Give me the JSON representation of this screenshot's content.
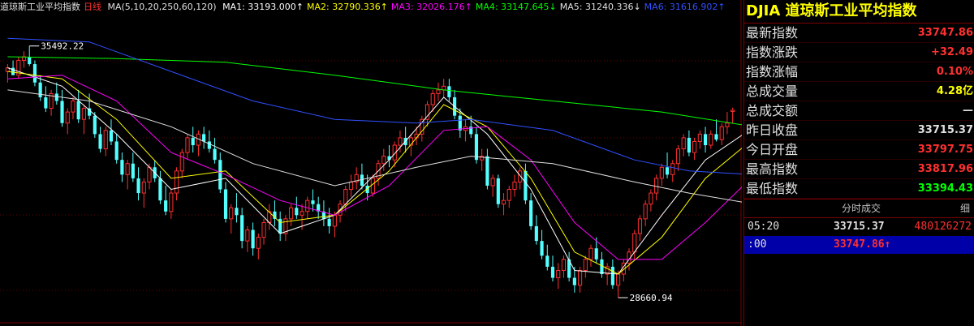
{
  "header": {
    "title": "道琼斯工业平均指数",
    "period": "日线",
    "ma_params": "MA(5,10,20,250,60,120)",
    "mas": [
      {
        "label": "MA1:",
        "value": "33193.000",
        "arrow": "↑",
        "color": "#ffffff"
      },
      {
        "label": "MA2:",
        "value": "32790.336",
        "arrow": "↑",
        "color": "#ffff00"
      },
      {
        "label": "MA3:",
        "value": "32026.176",
        "arrow": "↑",
        "color": "#ff00ff"
      },
      {
        "label": "MA4:",
        "value": "33147.645",
        "arrow": "↓",
        "color": "#00ff00"
      },
      {
        "label": "MA5:",
        "value": "31240.336",
        "arrow": "↓",
        "color": "#e0e0e0"
      },
      {
        "label": "MA6:",
        "value": "31616.902",
        "arrow": "↑",
        "color": "#3050ff"
      }
    ]
  },
  "chart_data": {
    "type": "candlestick",
    "title": "道琼斯工业平均指数",
    "ylim": [
      28200,
      36300
    ],
    "high_label": "35492.22",
    "low_label": "28660.94",
    "up_color": "#ff3030",
    "down_color": "#54ffff",
    "candles": [
      [
        34800,
        35000,
        34500,
        34900
      ],
      [
        34900,
        35100,
        34700,
        34700
      ],
      [
        34700,
        35200,
        34600,
        35100
      ],
      [
        35100,
        35350,
        34900,
        35200
      ],
      [
        35200,
        35492,
        34950,
        35000
      ],
      [
        35000,
        35100,
        34400,
        34500
      ],
      [
        34500,
        34700,
        34000,
        34100
      ],
      [
        34100,
        34400,
        33700,
        33800
      ],
      [
        33800,
        34300,
        33600,
        34200
      ],
      [
        34200,
        34500,
        33900,
        34000
      ],
      [
        34000,
        34300,
        33300,
        33400
      ],
      [
        33400,
        33800,
        33100,
        33700
      ],
      [
        33700,
        34100,
        33500,
        34000
      ],
      [
        34000,
        34300,
        33400,
        33500
      ],
      [
        33500,
        33900,
        33100,
        33800
      ],
      [
        33800,
        34200,
        33500,
        33600
      ],
      [
        33600,
        33700,
        33000,
        33100
      ],
      [
        33100,
        33300,
        32600,
        32700
      ],
      [
        32700,
        33300,
        32500,
        33200
      ],
      [
        33200,
        33500,
        32800,
        32900
      ],
      [
        32900,
        33100,
        32300,
        32400
      ],
      [
        32400,
        32600,
        31800,
        32000
      ],
      [
        32000,
        32400,
        31600,
        32300
      ],
      [
        32300,
        32600,
        31800,
        31900
      ],
      [
        31900,
        32200,
        31300,
        31500
      ],
      [
        31500,
        31900,
        31100,
        31800
      ],
      [
        31800,
        32300,
        31600,
        32200
      ],
      [
        32200,
        32400,
        31800,
        31900
      ],
      [
        31900,
        32100,
        31200,
        31300
      ],
      [
        31300,
        31700,
        30900,
        31000
      ],
      [
        31000,
        31600,
        30800,
        31500
      ],
      [
        31500,
        32200,
        31300,
        32100
      ],
      [
        32100,
        32700,
        31900,
        32600
      ],
      [
        32600,
        33100,
        32400,
        33000
      ],
      [
        33000,
        33300,
        32600,
        32800
      ],
      [
        32800,
        33200,
        32500,
        33100
      ],
      [
        33100,
        33300,
        32700,
        32900
      ],
      [
        32900,
        33200,
        32600,
        32700
      ],
      [
        32700,
        33000,
        32300,
        32400
      ],
      [
        32400,
        32600,
        31500,
        31600
      ],
      [
        31600,
        31800,
        30700,
        30800
      ],
      [
        30800,
        31200,
        30400,
        31100
      ],
      [
        31100,
        31500,
        30700,
        30900
      ],
      [
        30900,
        31100,
        30000,
        30200
      ],
      [
        30200,
        30600,
        29900,
        30500
      ],
      [
        30500,
        30700,
        29800,
        30000
      ],
      [
        30000,
        30400,
        29700,
        30300
      ],
      [
        30300,
        30800,
        30100,
        30700
      ],
      [
        30700,
        31200,
        30500,
        31000
      ],
      [
        31000,
        31300,
        30600,
        30800
      ],
      [
        30800,
        31000,
        30200,
        30400
      ],
      [
        30400,
        30900,
        30200,
        30800
      ],
      [
        30800,
        31200,
        30600,
        31100
      ],
      [
        31100,
        31400,
        30800,
        30900
      ],
      [
        30900,
        31200,
        30500,
        31000
      ],
      [
        31000,
        31400,
        30800,
        31300
      ],
      [
        31300,
        31600,
        31000,
        31200
      ],
      [
        31200,
        31400,
        30800,
        31000
      ],
      [
        31000,
        31300,
        30600,
        30800
      ],
      [
        30800,
        31100,
        30400,
        30600
      ],
      [
        30600,
        31000,
        30300,
        30900
      ],
      [
        30900,
        31300,
        30700,
        31200
      ],
      [
        31200,
        31700,
        31000,
        31600
      ],
      [
        31600,
        32000,
        31400,
        31800
      ],
      [
        31800,
        32200,
        31600,
        32000
      ],
      [
        32000,
        32300,
        31600,
        31700
      ],
      [
        31700,
        32000,
        31300,
        31500
      ],
      [
        31500,
        32000,
        31400,
        31900
      ],
      [
        31900,
        32400,
        31700,
        32300
      ],
      [
        32300,
        32700,
        32100,
        32500
      ],
      [
        32500,
        32800,
        32200,
        32400
      ],
      [
        32400,
        32900,
        32200,
        32800
      ],
      [
        32800,
        33200,
        32600,
        33000
      ],
      [
        33000,
        33300,
        32600,
        32800
      ],
      [
        32800,
        33100,
        32500,
        33000
      ],
      [
        33000,
        33300,
        32800,
        33100
      ],
      [
        33100,
        33600,
        32900,
        33500
      ],
      [
        33500,
        34000,
        33300,
        33900
      ],
      [
        33900,
        34300,
        33700,
        34200
      ],
      [
        34200,
        34500,
        34000,
        34300
      ],
      [
        34300,
        34600,
        34100,
        34400
      ],
      [
        34400,
        34600,
        34000,
        34100
      ],
      [
        34100,
        34300,
        33500,
        33600
      ],
      [
        33600,
        33800,
        33000,
        33200
      ],
      [
        33200,
        33500,
        32900,
        33300
      ],
      [
        33300,
        33600,
        33000,
        33100
      ],
      [
        33100,
        33300,
        32300,
        32400
      ],
      [
        32400,
        32700,
        32100,
        32500
      ],
      [
        32500,
        32700,
        31600,
        31700
      ],
      [
        31700,
        32000,
        31400,
        31900
      ],
      [
        31900,
        32000,
        31100,
        31200
      ],
      [
        31200,
        31500,
        30900,
        31300
      ],
      [
        31300,
        31700,
        31100,
        31600
      ],
      [
        31600,
        32000,
        31400,
        31800
      ],
      [
        31800,
        32200,
        31600,
        32100
      ],
      [
        32100,
        32300,
        31200,
        31300
      ],
      [
        31300,
        31500,
        30500,
        30600
      ],
      [
        30600,
        30900,
        30100,
        30200
      ],
      [
        30200,
        30500,
        29700,
        29800
      ],
      [
        29800,
        30100,
        29400,
        29500
      ],
      [
        29500,
        29800,
        29100,
        29200
      ],
      [
        29200,
        29600,
        28900,
        29400
      ],
      [
        29400,
        29800,
        29200,
        29700
      ],
      [
        29700,
        29900,
        29100,
        29200
      ],
      [
        29200,
        29500,
        28800,
        29000
      ],
      [
        29000,
        29500,
        28800,
        29400
      ],
      [
        29400,
        29800,
        29200,
        29700
      ],
      [
        29700,
        30100,
        29500,
        30000
      ],
      [
        30000,
        30300,
        29600,
        29700
      ],
      [
        29700,
        29900,
        29200,
        29300
      ],
      [
        29300,
        29600,
        29000,
        29500
      ],
      [
        29500,
        29700,
        28900,
        29000
      ],
      [
        29000,
        29400,
        28661,
        29300
      ],
      [
        29300,
        29700,
        29100,
        29600
      ],
      [
        29600,
        30000,
        29400,
        29900
      ],
      [
        29900,
        30500,
        29700,
        30400
      ],
      [
        30400,
        30900,
        30200,
        30800
      ],
      [
        30800,
        31300,
        30600,
        31200
      ],
      [
        31200,
        31600,
        31000,
        31500
      ],
      [
        31500,
        32000,
        31300,
        31900
      ],
      [
        31900,
        32300,
        31700,
        32200
      ],
      [
        32200,
        32600,
        31900,
        32000
      ],
      [
        32000,
        32400,
        31800,
        32300
      ],
      [
        32300,
        32800,
        32100,
        32700
      ],
      [
        32700,
        33100,
        32500,
        33000
      ],
      [
        33000,
        33200,
        32500,
        32600
      ],
      [
        32600,
        33000,
        32400,
        32900
      ],
      [
        32900,
        33200,
        32700,
        33100
      ],
      [
        33100,
        33300,
        32600,
        32800
      ],
      [
        32800,
        33200,
        32700,
        33100
      ],
      [
        33100,
        33500,
        32900,
        32950
      ],
      [
        32950,
        33400,
        32800,
        33300
      ],
      [
        33300,
        33700,
        33100,
        33400
      ],
      [
        33715,
        33818,
        33394,
        33748
      ]
    ],
    "ma": [
      {
        "name": "MA1",
        "color": "#ffffff",
        "points": [
          [
            0,
            34900
          ],
          [
            10,
            34400
          ],
          [
            20,
            33100
          ],
          [
            30,
            31600
          ],
          [
            40,
            31900
          ],
          [
            50,
            30400
          ],
          [
            60,
            30900
          ],
          [
            70,
            32400
          ],
          [
            80,
            34100
          ],
          [
            88,
            33100
          ],
          [
            96,
            31600
          ],
          [
            104,
            29400
          ],
          [
            112,
            29300
          ],
          [
            120,
            30900
          ],
          [
            128,
            32400
          ],
          [
            137,
            33300
          ]
        ]
      },
      {
        "name": "MA2",
        "color": "#ffff00",
        "points": [
          [
            0,
            34800
          ],
          [
            10,
            34600
          ],
          [
            20,
            33500
          ],
          [
            30,
            31900
          ],
          [
            40,
            32100
          ],
          [
            50,
            30700
          ],
          [
            60,
            30900
          ],
          [
            70,
            32100
          ],
          [
            80,
            33900
          ],
          [
            88,
            33300
          ],
          [
            96,
            31900
          ],
          [
            104,
            29900
          ],
          [
            112,
            29300
          ],
          [
            120,
            30300
          ],
          [
            128,
            31900
          ],
          [
            137,
            33000
          ]
        ]
      },
      {
        "name": "MA3",
        "color": "#ff00ff",
        "points": [
          [
            0,
            34600
          ],
          [
            10,
            34700
          ],
          [
            20,
            34000
          ],
          [
            30,
            32600
          ],
          [
            40,
            32000
          ],
          [
            50,
            31300
          ],
          [
            60,
            30900
          ],
          [
            70,
            31700
          ],
          [
            80,
            33200
          ],
          [
            88,
            33300
          ],
          [
            96,
            32400
          ],
          [
            104,
            30700
          ],
          [
            112,
            29700
          ],
          [
            120,
            29700
          ],
          [
            128,
            30700
          ],
          [
            137,
            32000
          ]
        ]
      },
      {
        "name": "MA4",
        "color": "#00ff00",
        "points": [
          [
            0,
            35200
          ],
          [
            20,
            35150
          ],
          [
            40,
            35050
          ],
          [
            60,
            34700
          ],
          [
            80,
            34300
          ],
          [
            100,
            34000
          ],
          [
            120,
            33700
          ],
          [
            137,
            33300
          ]
        ]
      },
      {
        "name": "MA5",
        "color": "#e0e0e0",
        "points": [
          [
            0,
            34300
          ],
          [
            15,
            34000
          ],
          [
            30,
            33300
          ],
          [
            45,
            32300
          ],
          [
            60,
            31700
          ],
          [
            75,
            32200
          ],
          [
            85,
            32500
          ],
          [
            100,
            32300
          ],
          [
            115,
            31800
          ],
          [
            125,
            31500
          ],
          [
            137,
            31200
          ]
        ]
      },
      {
        "name": "MA6",
        "color": "#3050ff",
        "points": [
          [
            0,
            35700
          ],
          [
            15,
            35600
          ],
          [
            30,
            34800
          ],
          [
            45,
            34000
          ],
          [
            60,
            33500
          ],
          [
            75,
            33400
          ],
          [
            85,
            33500
          ],
          [
            100,
            33200
          ],
          [
            115,
            32400
          ],
          [
            125,
            32100
          ],
          [
            137,
            32000
          ]
        ]
      }
    ]
  },
  "panel": {
    "title": "DJIA 道琼斯工业平均指数",
    "stats": [
      {
        "label": "最新指数",
        "value": "33747.86",
        "color": "#ff3030"
      },
      {
        "label": "指数涨跌",
        "value": "+32.49",
        "color": "#ff3030"
      },
      {
        "label": "指数涨幅",
        "value": "0.10%",
        "color": "#ff3030"
      },
      {
        "label": "总成交量",
        "value": "4.28亿",
        "color": "#ffff00"
      },
      {
        "label": "总成交额",
        "value": "—",
        "color": "#e0e0e0"
      },
      {
        "label": "昨日收盘",
        "value": "33715.37",
        "color": "#e0e0e0"
      },
      {
        "label": "今日开盘",
        "value": "33797.75",
        "color": "#ff3030"
      },
      {
        "label": "最高指数",
        "value": "33817.96",
        "color": "#ff3030"
      },
      {
        "label": "最低指数",
        "value": "33394.43",
        "color": "#00ff00"
      }
    ],
    "trade_header": {
      "col1": "分时成交",
      "col2": "细"
    },
    "trades": [
      {
        "time": "05:20",
        "price": "33715.37",
        "vol": "480126272"
      },
      {
        "time": ":00",
        "price": "33747.86↑",
        "vol": ""
      }
    ]
  }
}
